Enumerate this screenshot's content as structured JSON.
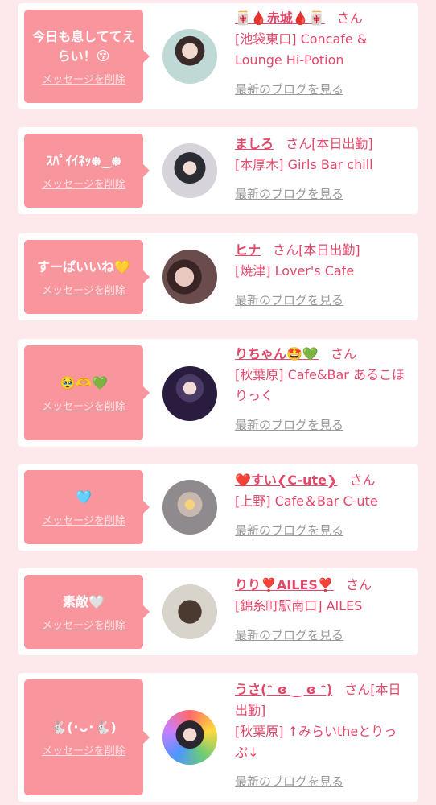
{
  "delete_label": "メッセージを削除",
  "blog_label": "最新のブログを見る",
  "entries": [
    {
      "message": "今日も息しててえらい！😚",
      "name": "🀄🩸赤城🩸🀄",
      "suffix": "さん",
      "shop": "[池袋東口] Concafe & Lounge Hi-Potion"
    },
    {
      "message": "ｽﾊﾟｲｲﾈｯ᪥‿᪥",
      "name": "ましろ",
      "suffix": "さん[本日出勤]",
      "shop": "[本厚木] Girls Bar chill"
    },
    {
      "message": "すーぱいいね💛",
      "name": "ヒナ",
      "suffix": "さん[本日出勤]",
      "shop": "[焼津] Lover's Cafe"
    },
    {
      "message": "🥹🫶💚",
      "name": "りちゃん🤩💚",
      "suffix": "さん",
      "shop": "[秋葉原] Cafe&Bar あるこほりっく"
    },
    {
      "message": "🩵",
      "name": "❤️すい❮C-ute❯",
      "suffix": "さん",
      "shop": "[上野] Cafe＆Bar C-ute"
    },
    {
      "message": "素敵🤍",
      "name": "りり❣️AILES❣️",
      "suffix": "さん",
      "shop": "[錦糸町駅南口] AILES"
    },
    {
      "message": "🐇(･ᴗ･🐇)",
      "name": "うさ(ᵔ ɞ ‿ ɞ ᵔ)",
      "suffix": "さん[本日出勤]",
      "shop": "[秋葉原] ↑みらいtheとりっぷ↓"
    }
  ]
}
